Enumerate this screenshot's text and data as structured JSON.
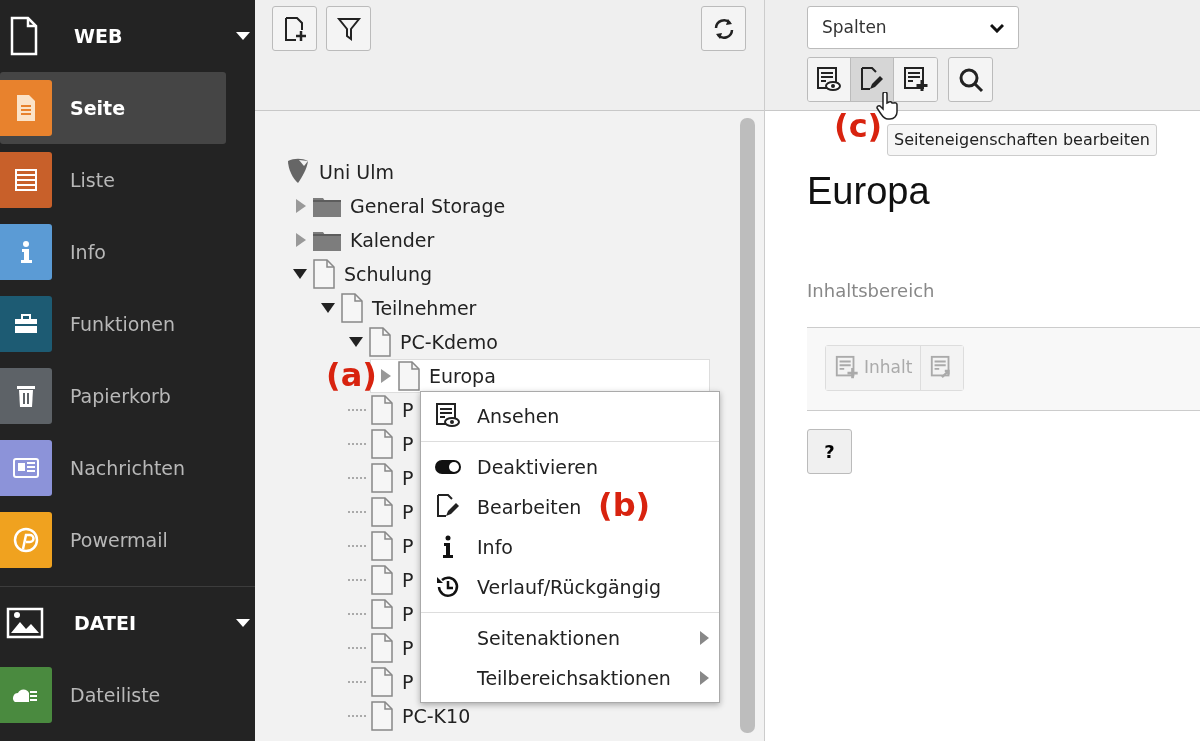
{
  "sidebar": {
    "groups": [
      {
        "label": "WEB",
        "expanded": true,
        "items": [
          {
            "label": "Seite",
            "color": "#e8822d",
            "selected": true
          },
          {
            "label": "Liste",
            "color": "#c8602a",
            "selected": false
          },
          {
            "label": "Info",
            "color": "#5b9bd5",
            "selected": false
          },
          {
            "label": "Funktionen",
            "color": "#1d5b73",
            "selected": false
          },
          {
            "label": "Papierkorb",
            "color": "#5d6267",
            "selected": false
          },
          {
            "label": "Nachrichten",
            "color": "#8c93d9",
            "selected": false
          },
          {
            "label": "Powermail",
            "color": "#f0a21f",
            "selected": false
          }
        ]
      },
      {
        "label": "DATEI",
        "expanded": true,
        "items": [
          {
            "label": "Dateiliste",
            "color": "#4a8a3f",
            "selected": false
          }
        ]
      }
    ]
  },
  "page_tree": {
    "items": [
      {
        "label": "Uni Ulm",
        "kind": "site",
        "selected": false,
        "children": [
          {
            "label": "General Storage",
            "kind": "folder",
            "expanded": false,
            "selected": false
          },
          {
            "label": "Kalender",
            "kind": "folder",
            "expanded": false,
            "selected": false
          },
          {
            "label": "Schulung",
            "kind": "page",
            "expanded": true,
            "selected": false,
            "children": [
              {
                "label": "Teilnehmer",
                "kind": "page",
                "expanded": true,
                "selected": false,
                "children": [
                  {
                    "label": "PC-Kdemo",
                    "kind": "page",
                    "expanded": true,
                    "selected": false,
                    "children": [
                      {
                        "label": "Europa",
                        "kind": "page",
                        "expanded": false,
                        "selected": true
                      },
                      {
                        "label": "P",
                        "kind": "page",
                        "selected": false
                      },
                      {
                        "label": "P",
                        "kind": "page",
                        "selected": false
                      },
                      {
                        "label": "P",
                        "kind": "page",
                        "selected": false
                      },
                      {
                        "label": "P",
                        "kind": "page",
                        "selected": false
                      },
                      {
                        "label": "P",
                        "kind": "page",
                        "selected": false
                      },
                      {
                        "label": "P",
                        "kind": "page",
                        "selected": false
                      },
                      {
                        "label": "P",
                        "kind": "page",
                        "selected": false
                      },
                      {
                        "label": "P",
                        "kind": "page",
                        "selected": false
                      },
                      {
                        "label": "P",
                        "kind": "page",
                        "selected": false
                      },
                      {
                        "label": "PC-K10",
                        "kind": "page",
                        "selected": false
                      }
                    ]
                  }
                ]
              }
            ]
          }
        ]
      }
    ]
  },
  "context_menu": {
    "sections": [
      [
        {
          "label": "Ansehen",
          "kind": "action"
        }
      ],
      [
        {
          "label": "Deaktivieren",
          "kind": "action"
        },
        {
          "label": "Bearbeiten",
          "kind": "action"
        },
        {
          "label": "Info",
          "kind": "action"
        },
        {
          "label": "Verlauf/Rückgängig",
          "kind": "action"
        }
      ],
      [
        {
          "label": "Seitenaktionen",
          "kind": "submenu"
        },
        {
          "label": "Teilbereichsaktionen",
          "kind": "submenu"
        }
      ]
    ]
  },
  "doc_header": {
    "view_select": {
      "value": "Spalten"
    },
    "buttons": [
      {
        "active": false
      },
      {
        "active": true
      },
      {
        "active": false
      }
    ],
    "tooltip": "Seiteneigenschaften bearbeiten"
  },
  "content": {
    "title": "Europa",
    "column": "Inhaltsbereich",
    "new_content_button": "Inhalt",
    "help_button": "?"
  },
  "annotations": [
    {
      "label": "(a)"
    },
    {
      "label": "(b)"
    },
    {
      "label": "(c)"
    }
  ]
}
